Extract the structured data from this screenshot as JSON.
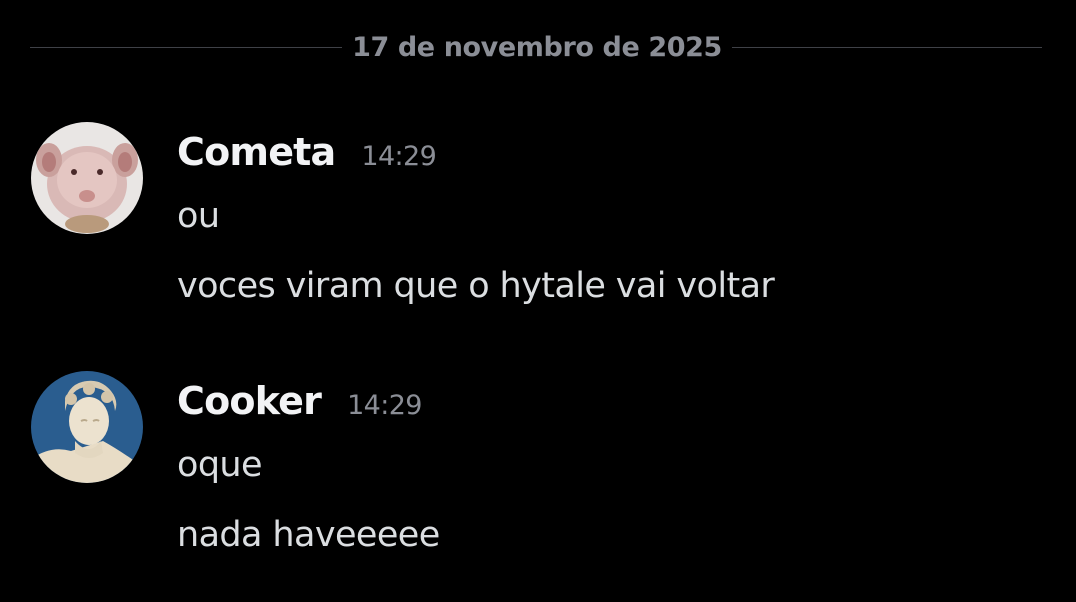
{
  "date_divider": {
    "label": "17 de novembro de 2025"
  },
  "messages": [
    {
      "author": "Cometa",
      "time": "14:29",
      "avatar_icon": "hairless-rat-avatar",
      "lines": [
        "ou",
        "voces viram que o hytale vai voltar"
      ]
    },
    {
      "author": "Cooker",
      "time": "14:29",
      "avatar_icon": "marble-statue-avatar",
      "lines": [
        "oque",
        "nada haveeeee"
      ]
    }
  ],
  "colors": {
    "background": "#000000",
    "username": "#f2f3f5",
    "message_text": "#dbdee1",
    "muted": "#8b8e96",
    "divider": "#3f4147",
    "avatar_sky": "#2a5d8f"
  }
}
